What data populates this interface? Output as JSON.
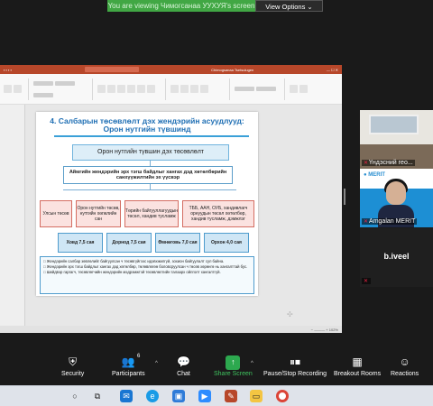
{
  "share_banner": {
    "text": "You are viewing Чимогсанаа УУХУЯ's screen",
    "options_label": "View Options ⌄"
  },
  "ppt": {
    "title": "Chimogsanaa Tsetsulugen",
    "status": "− ——— + 102%"
  },
  "slide": {
    "title_line1": "4. Салбарын төсөвлөлт дэх жендэрийн асуудлууд:",
    "title_line2": "Орон нутгийн түвшинд",
    "top_box": "Орон нутгийн түвшин дэх төсөвлөлт",
    "second_box": "Аймгийн жендэрийн эрх тэгш байдлыг хангах дэд хөтөлбөрийн санхүүжилтийн эх үүсвэр",
    "pink_boxes": [
      "Улсын төсөв",
      "Орон нутгийн төсөв, нутгийн хөгжлийн сан",
      "Төрийн байгууллагуудын төсөл, хандив тусламж",
      "ТББ, ААН, ОУБ, хандивлагч орнуудын төсөл хөтөлбөр, хандив тусламж, дэмжлэг"
    ],
    "blue_boxes": [
      "Ховд 7,5 сая",
      "Дорнод 7,5 сая",
      "Өмнөговь 7,0 сая",
      "Орхон 4,0 сая"
    ],
    "notes": [
      "Жендэрийн салбар зөвлөлийг байгуулсан ч төсөвгүйгээс идэвхжилгүй, зохион байгуулалт сул байна.",
      "Жендэрийн эрх тэгш байдлыг хангах дэд хөтөлбөр, төлөвлөгөө боловсруулсан ч төсөв хөрөнгө нь хангалттай бус.",
      "Шийдвэр гаргагч, төсөвлөгчийн жендэрийн мэдрэмжтэй төсөвлөлтийн талаарх ойлголт хангалтгүй."
    ]
  },
  "participants": [
    {
      "name": "Үндэсний гео..."
    },
    {
      "name": "Amgalan MERIT"
    },
    {
      "name": "b.iveel",
      "big_name": "b.iveel"
    }
  ],
  "toolbar": {
    "security": "Security",
    "participants": "Participants",
    "participants_count": "6",
    "chat": "Chat",
    "share_screen": "Share Screen",
    "pause_recording": "Pause/Stop Recording",
    "breakout_rooms": "Breakout Rooms",
    "reactions": "Reactions"
  },
  "colors": {
    "share_green": "#41a744",
    "ppt_red": "#b7472a",
    "slide_title_blue": "#1f6fb4"
  },
  "taskbar_icons": [
    "search-icon",
    "task-view-icon",
    "mail-icon",
    "edge-icon",
    "photos-icon",
    "zoom-icon",
    "paint-icon",
    "explorer-icon",
    "chrome-icon"
  ]
}
